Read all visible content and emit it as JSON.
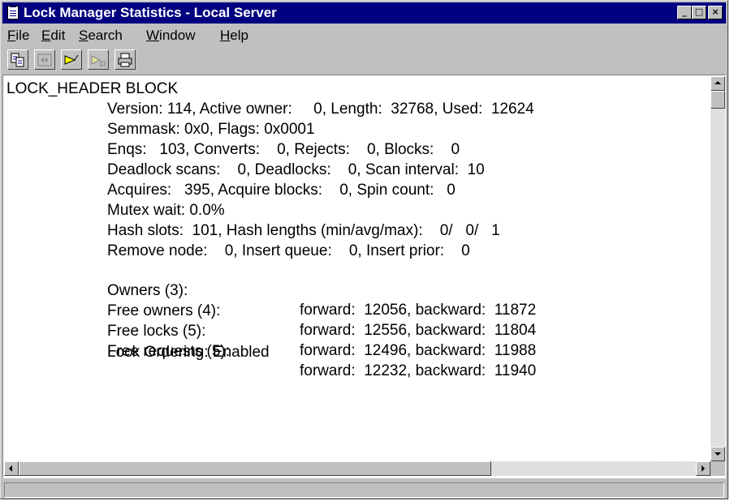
{
  "window": {
    "title": "Lock Manager Statistics - Local Server",
    "controls": {
      "minimize": "_",
      "maximize": "□",
      "close": "×"
    }
  },
  "menu": [
    {
      "label": "File"
    },
    {
      "label": "Edit"
    },
    {
      "label": "Search"
    },
    {
      "label": "Window"
    },
    {
      "label": "Help"
    }
  ],
  "toolbar": [
    {
      "icon": "copy-paste-icon",
      "enabled": true
    },
    {
      "icon": "split-icon",
      "enabled": false
    },
    {
      "icon": "find-icon",
      "enabled": true
    },
    {
      "icon": "find-next-icon",
      "enabled": false
    },
    {
      "icon": "print-icon",
      "enabled": true
    }
  ],
  "content": {
    "header": "LOCK_HEADER BLOCK",
    "lines": [
      "Version: 114, Active owner:     0, Length:  32768, Used:  12624",
      "Semmask: 0x0, Flags: 0x0001",
      "Enqs:   103, Converts:    0, Rejects:    0, Blocks:    0",
      "Deadlock scans:    0, Deadlocks:    0, Scan interval:  10",
      "Acquires:   395, Acquire blocks:    0, Spin count:   0",
      "Mutex wait: 0.0%",
      "Hash slots:  101, Hash lengths (min/avg/max):    0/   0/   1",
      "Remove node:    0, Insert queue:    0, Insert prior:    0"
    ],
    "queues": [
      {
        "label": "Owners (3):",
        "links": "forward:  12056, backward:  11872"
      },
      {
        "label": "Free owners (4):",
        "links": "forward:  12556, backward:  11804"
      },
      {
        "label": "Free locks (5):",
        "links": "forward:  12496, backward:  11988"
      },
      {
        "label": "Free requests (5):",
        "links": "forward:  12232, backward:  11940"
      }
    ],
    "footer": "Lock Ordering: Enabled"
  },
  "status": {
    "text": ""
  }
}
